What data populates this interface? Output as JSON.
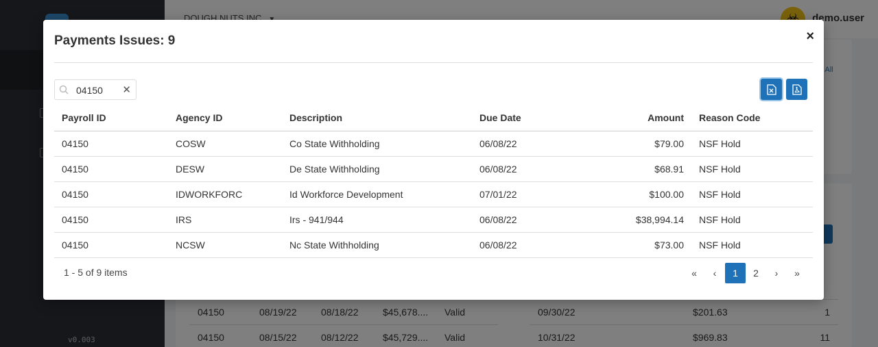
{
  "app": {
    "company": "DOUGH NUTS INC",
    "user": "demo.user",
    "version": "v0.003",
    "view_all": "w All"
  },
  "background_rows": [
    {
      "payroll": "04150",
      "d1": "08/19/22",
      "d2": "08/18/22",
      "amount": "$45,678....",
      "status": "Valid",
      "due": "09/30/22",
      "total": "$201.63",
      "count": "1"
    },
    {
      "payroll": "04150",
      "d1": "08/15/22",
      "d2": "08/12/22",
      "amount": "$45,729....",
      "status": "Valid",
      "due": "10/31/22",
      "total": "$969.83",
      "count": "11"
    }
  ],
  "modal": {
    "title": "Payments Issues: 9",
    "close": "×",
    "search": {
      "value": "04150",
      "clear": "✕"
    },
    "export_excel_icon": "excel-icon",
    "export_pdf_icon": "pdf-icon",
    "columns": [
      "Payroll ID",
      "Agency ID",
      "Description",
      "Due Date",
      "Amount",
      "Reason Code"
    ],
    "rows": [
      {
        "payroll_id": "04150",
        "agency_id": "COSW",
        "description": "Co State Withholding",
        "due_date": "06/08/22",
        "amount": "$79.00",
        "reason": "NSF Hold"
      },
      {
        "payroll_id": "04150",
        "agency_id": "DESW",
        "description": "De State Withholding",
        "due_date": "06/08/22",
        "amount": "$68.91",
        "reason": "NSF Hold"
      },
      {
        "payroll_id": "04150",
        "agency_id": "IDWORKFORC",
        "description": "Id Workforce Development",
        "due_date": "07/01/22",
        "amount": "$100.00",
        "reason": "NSF Hold"
      },
      {
        "payroll_id": "04150",
        "agency_id": "IRS",
        "description": "Irs - 941/944",
        "due_date": "06/08/22",
        "amount": "$38,994.14",
        "reason": "NSF Hold"
      },
      {
        "payroll_id": "04150",
        "agency_id": "NCSW",
        "description": "Nc State Withholding",
        "due_date": "06/08/22",
        "amount": "$73.00",
        "reason": "NSF Hold"
      }
    ],
    "pager": {
      "info": "1 - 5 of 9 items",
      "first": "«",
      "prev": "‹",
      "pages": [
        "1",
        "2"
      ],
      "current": "1",
      "next": "›",
      "last": "»"
    }
  }
}
